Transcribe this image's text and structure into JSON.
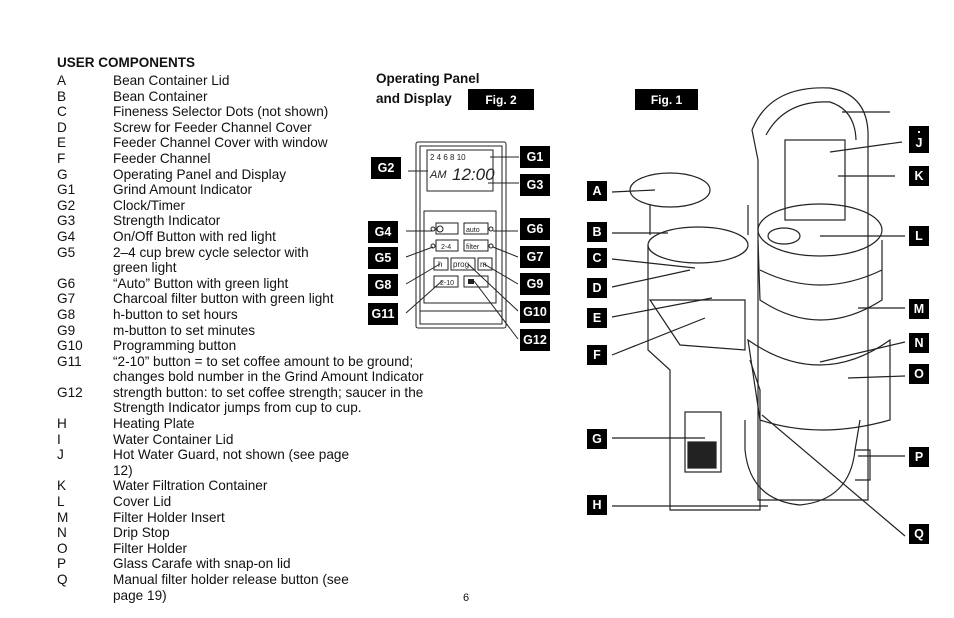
{
  "heading": "USER COMPONENTS",
  "components": [
    {
      "code": "A",
      "desc": "Bean Container Lid"
    },
    {
      "code": "B",
      "desc": "Bean Container"
    },
    {
      "code": "C",
      "desc": "Fineness Selector Dots (not shown)"
    },
    {
      "code": "D",
      "desc": "Screw for Feeder Channel Cover"
    },
    {
      "code": "E",
      "desc": "Feeder Channel Cover with window"
    },
    {
      "code": "F",
      "desc": "Feeder Channel"
    },
    {
      "code": "G",
      "desc": "Operating Panel and Display"
    },
    {
      "code": "G1",
      "desc": "Grind Amount Indicator"
    },
    {
      "code": "G2",
      "desc": "Clock/Timer"
    },
    {
      "code": "G3",
      "desc": "Strength Indicator"
    },
    {
      "code": "G4",
      "desc": "On/Off Button with red light"
    },
    {
      "code": "G5",
      "desc": "2–4 cup brew cycle selector with green light"
    },
    {
      "code": "G6",
      "desc": "“Auto” Button with green light"
    },
    {
      "code": "G7",
      "desc": "Charcoal filter button with green light"
    },
    {
      "code": "G8",
      "desc": "h-button to set hours"
    },
    {
      "code": "G9",
      "desc": "m-button to set minutes"
    },
    {
      "code": "G10",
      "desc": "Programming button"
    },
    {
      "code": "G11",
      "desc": "“2-10” button = to set coffee amount to be ground; changes bold number in the Grind Amount Indicator"
    },
    {
      "code": "G12",
      "desc": "strength button: to set coffee strength; saucer in the Strength Indicator jumps from cup to cup."
    },
    {
      "code": "H",
      "desc": "Heating Plate"
    },
    {
      "code": "I",
      "desc": "Water Container Lid"
    },
    {
      "code": "J",
      "desc": "Hot Water Guard, not shown (see page 12)"
    },
    {
      "code": "K",
      "desc": "Water Filtration Container"
    },
    {
      "code": "L",
      "desc": "Cover Lid"
    },
    {
      "code": "M",
      "desc": "Filter Holder Insert"
    },
    {
      "code": "N",
      "desc": "Drip Stop"
    },
    {
      "code": "O",
      "desc": "Filter Holder"
    },
    {
      "code": "P",
      "desc": "Glass Carafe with snap-on lid"
    },
    {
      "code": "Q",
      "desc": "Manual filter holder release button (see page 19)"
    }
  ],
  "panel": {
    "title_line1": "Operating Panel",
    "title_line2": "and Display",
    "fig_label": "Fig. 2",
    "display": {
      "grind_numbers": "2 4 6 8 10",
      "ampm": "AM",
      "time": "12:00"
    },
    "buttons": {
      "auto": "auto",
      "two_four": "2-4",
      "filter": "filter",
      "h": "h",
      "prog": "prog",
      "m": "m",
      "two_ten": "2-10"
    },
    "labels": [
      "G1",
      "G2",
      "G3",
      "G4",
      "G5",
      "G6",
      "G7",
      "G8",
      "G9",
      "G10",
      "G11",
      "G12"
    ]
  },
  "machine": {
    "fig_label": "Fig. 1",
    "labels": [
      "A",
      "B",
      "C",
      "D",
      "E",
      "F",
      "G",
      "H",
      "I",
      "J",
      "K",
      "L",
      "M",
      "N",
      "O",
      "P",
      "Q"
    ]
  },
  "page_number": "6"
}
